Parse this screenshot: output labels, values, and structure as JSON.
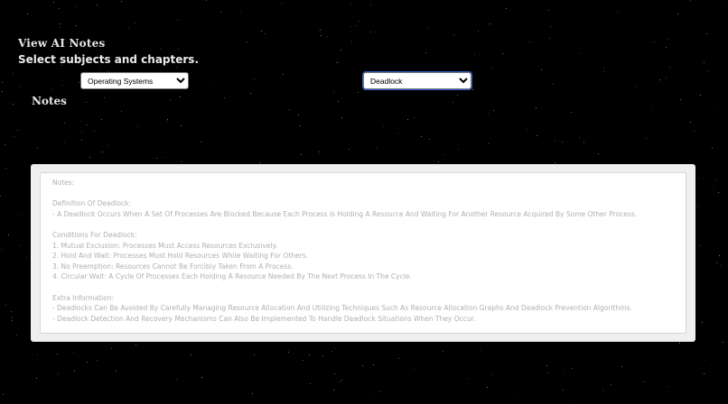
{
  "page": {
    "title": "View AI Notes",
    "subtitle": "Select subjects and chapters.",
    "notes_heading": "Notes"
  },
  "subject_select": {
    "selected": "Operating Systems"
  },
  "chapter_select": {
    "selected": "Deadlock"
  },
  "notes": {
    "lines": [
      "Notes:",
      "",
      "Definition Of Deadlock:",
      "- A Deadlock Occurs When A Set Of Processes Are Blocked Because Each Process Is Holding A Resource And Waiting For Another Resource Acquired By Some Other Process.",
      "",
      "Conditions For Deadlock:",
      "1. Mutual Exclusion: Processes Must Access Resources Exclusively.",
      "2. Hold And Wait: Processes Must Hold Resources While Waiting For Others.",
      "3. No Preemption: Resources Cannot Be Forcibly Taken From A Process.",
      "4. Circular Wait: A Cycle Of Processes Each Holding A Resource Needed By The Next Process In The Cycle.",
      "",
      "Extra Information:",
      "- Deadlocks Can Be Avoided By Carefully Managing Resource Allocation And Utilizing Techniques Such As Resource Allocation Graphs And Deadlock Prevention Algorithms.",
      "- Deadlock Detection And Recovery Mechanisms Can Also Be Implemented To Handle Deadlock Situations When They Occur."
    ]
  },
  "colors": {
    "background": "#000000",
    "panel": "#efefef",
    "notes_text": "#b0b0b0",
    "focus_outline": "#2a5fcf"
  }
}
